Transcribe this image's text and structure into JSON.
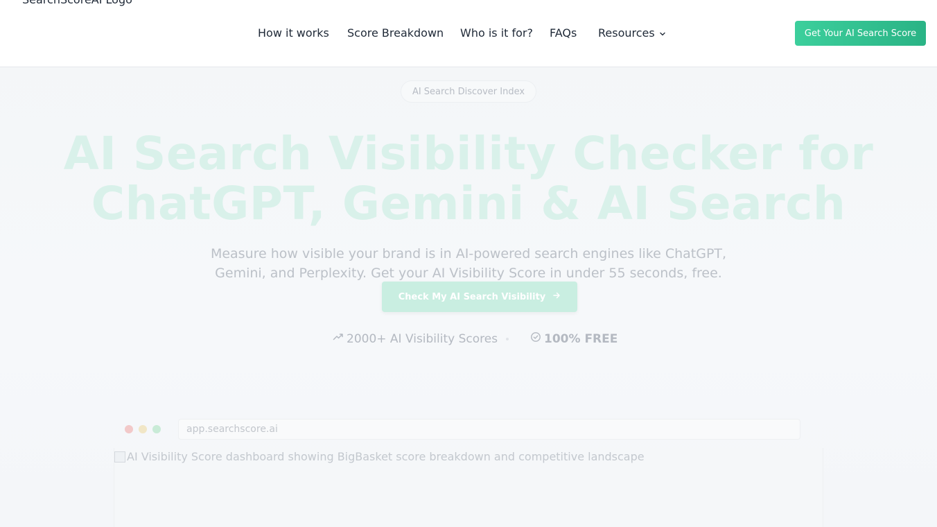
{
  "header": {
    "logo_alt": "SearchScoreAI Logo",
    "nav": {
      "how": "How it works",
      "score": "Score Breakdown",
      "who": "Who is it for?",
      "faqs": "FAQs",
      "resources": "Resources"
    },
    "cta": "Get Your AI Search Score"
  },
  "hero": {
    "badge": "AI Search Discover Index",
    "title_line1": "AI Search Visibility Checker for",
    "title_line2": "ChatGPT, Gemini & AI Search",
    "subtitle": "Measure how visible your brand is in AI-powered search engines like ChatGPT, Gemini, and Perplexity. Get your AI Visibility Score in under 55 seconds, free.",
    "cta": "Check My AI Search Visibility",
    "stats": {
      "scores": "2000+ AI Visibility Scores",
      "free": "100% FREE"
    }
  },
  "preview": {
    "url": "app.searchscore.ai",
    "image_alt": "AI Visibility Score dashboard showing BigBasket score breakdown and competitive landscape"
  },
  "icons": {
    "chevron": "chevron-down-icon",
    "arrow": "arrow-right-icon",
    "trend": "trending-up-icon",
    "check": "check-circle-icon"
  },
  "colors": {
    "accent": "#2ab385",
    "accent_light": "#c9eee1",
    "title_faded": "#d9f1ea"
  }
}
